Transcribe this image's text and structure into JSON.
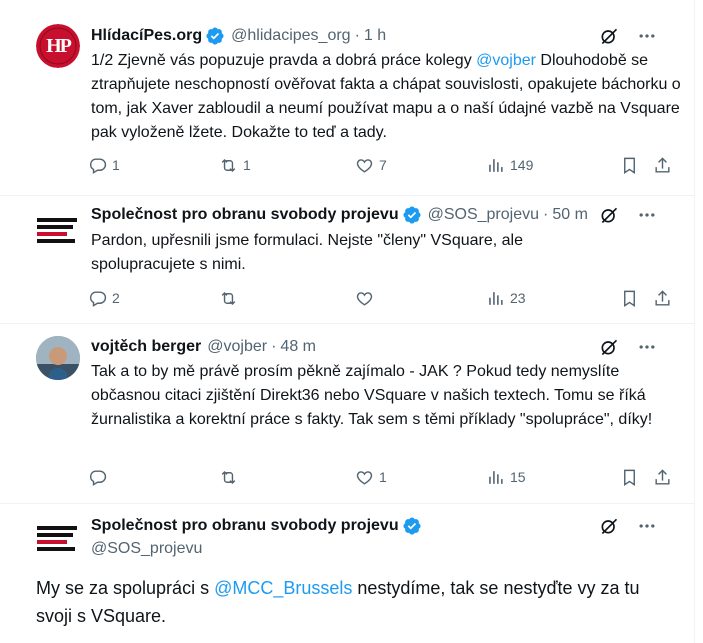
{
  "tweets": [
    {
      "name": "HlídacíPes.org",
      "handle": "@hlidacipes_org",
      "time": "1 h",
      "text_pre": "1/2 Zjevně vás popuzuje pravda a dobrá práce kolegy ",
      "mention": "@vojber",
      "text_post": " Dlouhodobě se ztrapňujete neschopností ověřovat fakta a chápat souvislosti, opakujete báchorku o tom, jak Xaver zabloudil a neumí používat mapu a o naší údajné vazbě na Vsquare pak vyloženě lžete. Dokažte to teď a tady.",
      "replies": "1",
      "reposts": "1",
      "likes": "7",
      "views": "149",
      "avatar_text": "HP"
    },
    {
      "name": "Společnost pro obranu svobody projevu",
      "handle": "@SOS_projevu",
      "time": "50 m",
      "text": "Pardon, upřesnili jsme formulaci. Nejste \"členy\" VSquare, ale spolupracujete s nimi.",
      "replies": "2",
      "reposts": "",
      "likes": "",
      "views": "23"
    },
    {
      "name": "vojtěch berger",
      "handle": "@vojber",
      "time": "48 m",
      "text": "Tak a to by mě právě prosím pěkně zajímalo - JAK ? Pokud tedy nemyslíte občasnou citaci zjištění Direkt36 nebo VSquare v našich textech. Tomu se říká žurnalistika a korektní práce s fakty. Tak sem s těmi příklady \"spolupráce\", díky!",
      "replies": "",
      "reposts": "",
      "likes": "1",
      "views": "15"
    },
    {
      "name": "Společnost pro obranu svobody projevu",
      "handle": "@SOS_projevu",
      "text_pre": "My se za spolupráci s ",
      "mention": "@MCC_Brussels",
      "text_post": " nestydíme, tak se nestyďte vy za tu svoji s VSquare."
    }
  ],
  "sos_logo_lines": [
    "SPOLEČNOST",
    "PRO OBRANU",
    "SVOBODY",
    "PROJEVU"
  ],
  "colors": {
    "accent": "#1d9bf0",
    "muted": "#536471",
    "text": "#0f1419",
    "verified": "#1d9bf0",
    "hp_red": "#c8102e"
  },
  "icons": [
    "verified-badge-icon",
    "grok-icon",
    "more-icon",
    "reply-icon",
    "repost-icon",
    "like-icon",
    "views-icon",
    "bookmark-icon",
    "share-icon"
  ]
}
